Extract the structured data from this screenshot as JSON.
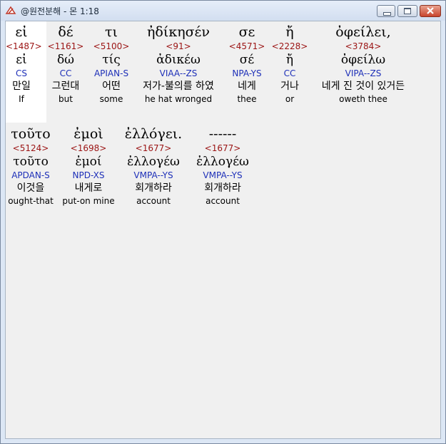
{
  "window": {
    "title": "@원전분해 - 몬 1:18"
  },
  "rows": [
    {
      "words": [
        {
          "greek": "εἰ",
          "strongs": "<1487>",
          "lemma": "εἰ",
          "parse": "CS",
          "korean": "만일",
          "english": "If"
        },
        {
          "greek": "δέ",
          "strongs": "<1161>",
          "lemma": "δώ",
          "parse": "CC",
          "korean": "그런대",
          "english": "but"
        },
        {
          "greek": "τι",
          "strongs": "<5100>",
          "lemma": "τίς",
          "parse": "APIAN-S",
          "korean": "어떤",
          "english": "some"
        },
        {
          "greek": "ἠδίκησέν",
          "strongs": "<91>",
          "lemma": "ἀδικέω",
          "parse": "VIAA--ZS",
          "korean": "저가-불의를 하였",
          "english": "he hat wronged"
        },
        {
          "greek": "σε",
          "strongs": "<4571>",
          "lemma": "σέ",
          "parse": "NPA-YS",
          "korean": "네게",
          "english": "thee"
        },
        {
          "greek": "ἤ",
          "strongs": "<2228>",
          "lemma": "ἤ",
          "parse": "CC",
          "korean": "거나",
          "english": "or"
        },
        {
          "greek": "ὀφείλει,",
          "strongs": "<3784>",
          "lemma": "ὀφείλω",
          "parse": "VIPA--ZS",
          "korean": "네게 진 것이 있거든",
          "english": "oweth thee"
        }
      ]
    },
    {
      "words": [
        {
          "greek": "τοῦτο",
          "strongs": "<5124>",
          "lemma": "τοῦτο",
          "parse": "APDAN-S",
          "korean": "이것을",
          "english": "ought-that"
        },
        {
          "greek": "ἐμοὶ",
          "strongs": "<1698>",
          "lemma": "ἐμοί",
          "parse": "NPD-XS",
          "korean": "내게로",
          "english": "put-on mine"
        },
        {
          "greek": "ἐλλόγει.",
          "strongs": "<1677>",
          "lemma": "ἐλλογέω",
          "parse": "VMPA--YS",
          "korean": "회개하라",
          "english": "account"
        },
        {
          "greek": "------",
          "strongs": "<1677>",
          "lemma": "ἐλλογέω",
          "parse": "VMPA--YS",
          "korean": "회개하라",
          "english": "account"
        }
      ]
    }
  ]
}
